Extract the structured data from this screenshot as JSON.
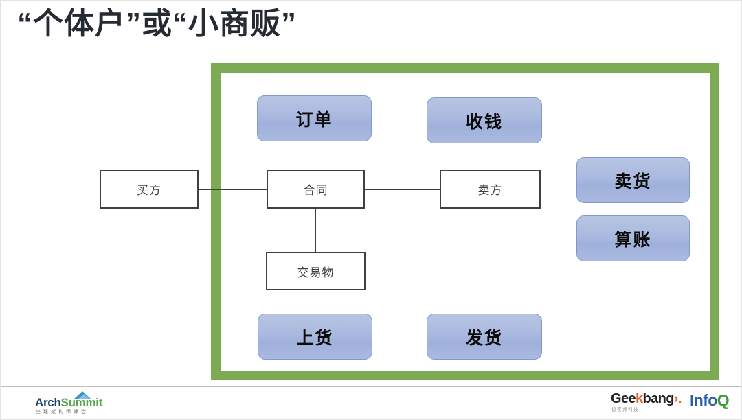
{
  "slide": {
    "title": "“个体户”或“小商贩”"
  },
  "diagram": {
    "frame_color": "#7cab54",
    "contract_nodes": [
      {
        "id": "buyer",
        "label": "买方"
      },
      {
        "id": "contract",
        "label": "合同"
      },
      {
        "id": "seller",
        "label": "卖方"
      },
      {
        "id": "goods",
        "label": "交易物"
      }
    ],
    "capability_nodes": [
      {
        "id": "order",
        "label": "订单"
      },
      {
        "id": "collect",
        "label": "收钱"
      },
      {
        "id": "sell",
        "label": "卖货"
      },
      {
        "id": "accounts",
        "label": "算账"
      },
      {
        "id": "stock",
        "label": "上货"
      },
      {
        "id": "ship",
        "label": "发货"
      }
    ]
  },
  "footer": {
    "archsummit": {
      "word_primary": "Arch",
      "word_secondary": "Summit",
      "subtitle": "全球架构师峰会"
    },
    "geekbang": {
      "part1": "Gee",
      "part_accent": "k",
      "part2": "bang",
      "chevron": "›.",
      "subtitle": "极客邦科技"
    },
    "infoq": {
      "part1": "Info",
      "part_accent": "Q"
    }
  }
}
